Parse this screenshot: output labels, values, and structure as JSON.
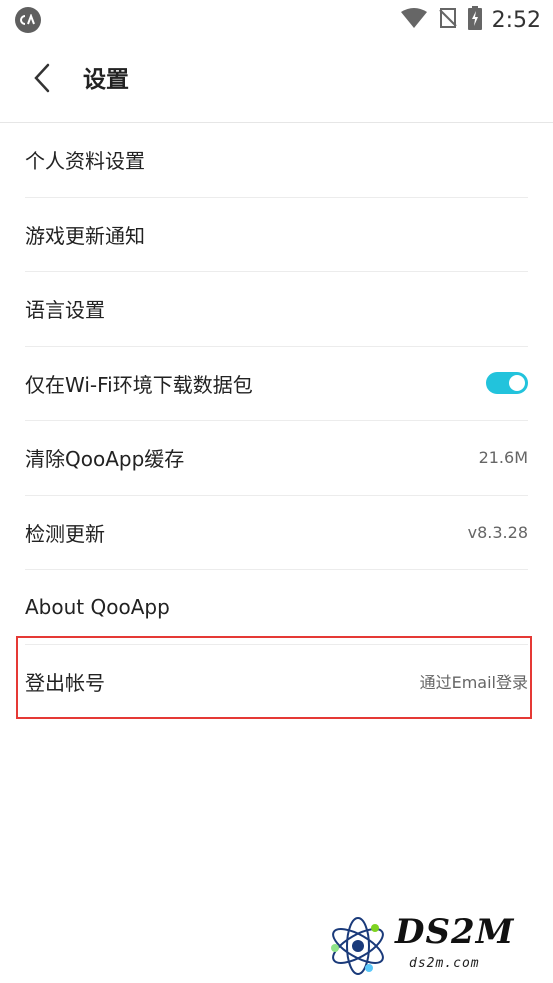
{
  "status_bar": {
    "app_icon": "qooapp-icon",
    "wifi_icon": "wifi-icon",
    "signal_icon": "no-signal-icon",
    "battery_icon": "battery-charging-icon",
    "time": "2:52"
  },
  "header": {
    "back_icon": "chevron-left-icon",
    "title": "设置"
  },
  "settings": {
    "profile": {
      "label": "个人资料设置"
    },
    "game_update_notify": {
      "label": "游戏更新通知"
    },
    "language": {
      "label": "语言设置"
    },
    "wifi_only_download": {
      "label": "仅在Wi-Fi环境下载数据包",
      "enabled": true
    },
    "clear_cache": {
      "label": "清除QooApp缓存",
      "value": "21.6M"
    },
    "check_update": {
      "label": "检测更新",
      "value": "v8.3.28"
    },
    "about": {
      "label": "About QooApp"
    },
    "logout": {
      "label": "登出帐号",
      "value": "通过Email登录"
    }
  },
  "colors": {
    "toggle_on": "#22c3dc",
    "highlight_border": "#e53935"
  },
  "watermark": {
    "brand": "DS2M",
    "site": "ds2m.com"
  }
}
